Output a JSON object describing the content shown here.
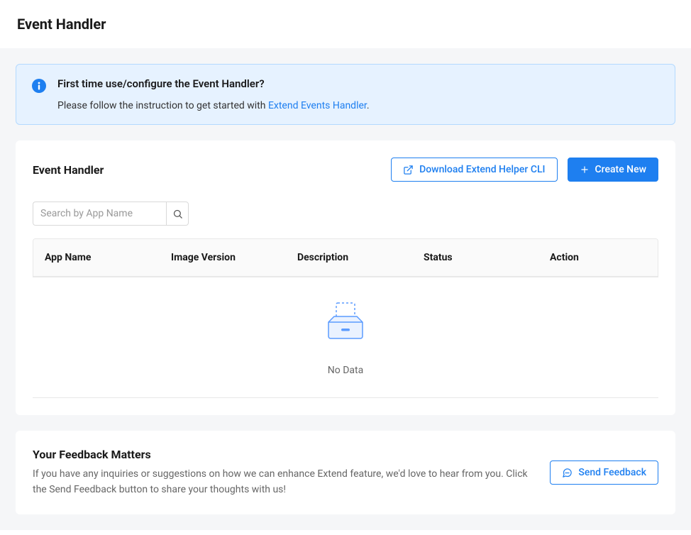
{
  "page": {
    "title": "Event Handler"
  },
  "banner": {
    "title": "First time use/configure the Event Handler?",
    "text": "Please follow the instruction to get started with ",
    "link": "Extend Events Handler",
    "period": "."
  },
  "section": {
    "title": "Event Handler",
    "download_btn": "Download Extend Helper CLI",
    "create_btn": "Create New"
  },
  "search": {
    "placeholder": "Search by App Name",
    "value": ""
  },
  "table": {
    "columns": {
      "app_name": "App Name",
      "image_version": "Image Version",
      "description": "Description",
      "status": "Status",
      "action": "Action"
    },
    "empty": "No Data"
  },
  "feedback": {
    "title": "Your Feedback Matters",
    "text": "If you have any inquiries or suggestions on how we can enhance Extend feature, we'd love to hear from you. Click the Send Feedback button to share your thoughts with us!",
    "button": "Send Feedback"
  }
}
